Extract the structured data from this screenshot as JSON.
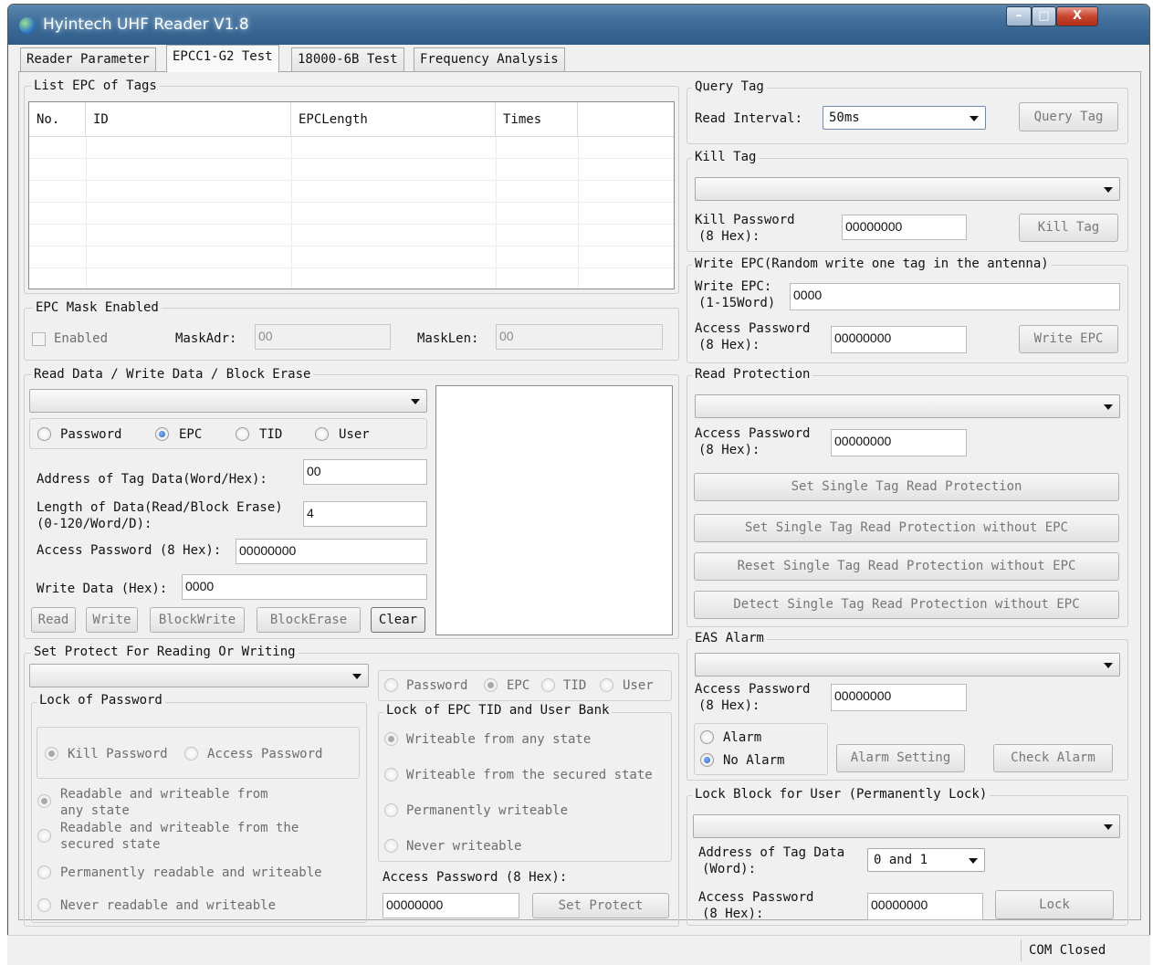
{
  "window": {
    "title": "Hyintech UHF Reader V1.8",
    "minimize": "–",
    "maximize": "□",
    "close": "X"
  },
  "tabs": [
    "Reader Parameter",
    "EPCC1-G2 Test",
    "18000-6B Test",
    "Frequency Analysis"
  ],
  "list_epc": {
    "legend": "List EPC of Tags",
    "columns": [
      "No.",
      "ID",
      "EPCLength",
      "Times",
      ""
    ]
  },
  "mask": {
    "legend": "EPC Mask Enabled",
    "enabled_label": "Enabled",
    "maskadr_label": "MaskAdr:",
    "maskadr_value": "00",
    "masklen_label": "MaskLen:",
    "masklen_value": "00"
  },
  "rw": {
    "legend": "Read Data / Write Data / Block Erase",
    "select_value": "",
    "mem_options": [
      "Password",
      "EPC",
      "TID",
      "User"
    ],
    "selected_mem": "EPC",
    "address_label": "Address of Tag Data(Word/Hex):",
    "address_value": "00",
    "length_label_1": "Length of Data(Read/Block Erase)",
    "length_label_2": "(0-120/Word/D):",
    "length_value": "4",
    "password_label": "Access Password (8 Hex):",
    "password_value": "00000000",
    "writedata_label": "Write Data (Hex):",
    "writedata_value": "0000",
    "buttons": {
      "read": "Read",
      "write": "Write",
      "blockwrite": "BlockWrite",
      "blockerase": "BlockErase",
      "clear": "Clear"
    }
  },
  "protect": {
    "legend": "Set Protect For Reading Or Writing",
    "select_value": "",
    "lock_password_legend": "Lock of Password",
    "kill_password": "Kill Password",
    "access_password": "Access Password",
    "options": [
      [
        "Readable and  writeable from",
        "any state"
      ],
      [
        "Readable and writeable from the",
        "secured state"
      ],
      [
        "Permanently readable and writeable"
      ],
      [
        "Never readable and writeable"
      ]
    ],
    "mem_options": [
      "Password",
      "EPC",
      "TID",
      "User"
    ],
    "selected_mem": "EPC",
    "lock_epc_legend": "Lock of EPC TID and User Bank",
    "epc_options": [
      "Writeable from any state",
      "Writeable from the secured state",
      "Permanently writeable",
      "Never writeable"
    ],
    "password_label": "Access Password (8 Hex):",
    "password_value": "00000000",
    "set_protect_button": "Set Protect"
  },
  "query": {
    "legend": "Query Tag",
    "interval_label": "Read Interval:",
    "interval_value": "50ms",
    "button": "Query Tag"
  },
  "kill": {
    "legend": "Kill Tag",
    "select_value": "",
    "password_label_1": "Kill Password",
    "password_label_2": "(8 Hex):",
    "password_value": "00000000",
    "button": "Kill Tag"
  },
  "write_epc": {
    "legend": "Write EPC(Random write one tag in the antenna)",
    "epc_label_1": "Write EPC:",
    "epc_label_2": "(1-15Word)",
    "epc_value": "0000",
    "password_label_1": "Access Password",
    "password_label_2": "(8 Hex):",
    "password_value": "00000000",
    "button": "Write EPC"
  },
  "read_protection": {
    "legend": "Read Protection",
    "select_value": "",
    "password_label_1": "Access Password",
    "password_label_2": "(8 Hex):",
    "password_value": "00000000",
    "buttons": [
      "Set Single Tag Read Protection",
      "Set Single Tag Read Protection without EPC",
      "Reset Single Tag Read Protection without EPC",
      "Detect Single Tag Read Protection without EPC"
    ]
  },
  "eas": {
    "legend": "EAS Alarm",
    "select_value": "",
    "password_label_1": "Access Password",
    "password_label_2": "(8 Hex):",
    "password_value": "00000000",
    "alarm": "Alarm",
    "no_alarm": "No Alarm",
    "alarm_setting_button": "Alarm Setting",
    "check_alarm_button": "Check Alarm"
  },
  "lock_block": {
    "legend": "Lock Block for User (Permanently Lock)",
    "select_value": "",
    "address_label_1": "Address of Tag Data",
    "address_label_2": "(Word):",
    "address_value": "0 and 1",
    "password_label_1": "Access Password",
    "password_label_2": "(8 Hex):",
    "password_value": "00000000",
    "button": "Lock"
  },
  "status": {
    "com": "COM Closed"
  }
}
